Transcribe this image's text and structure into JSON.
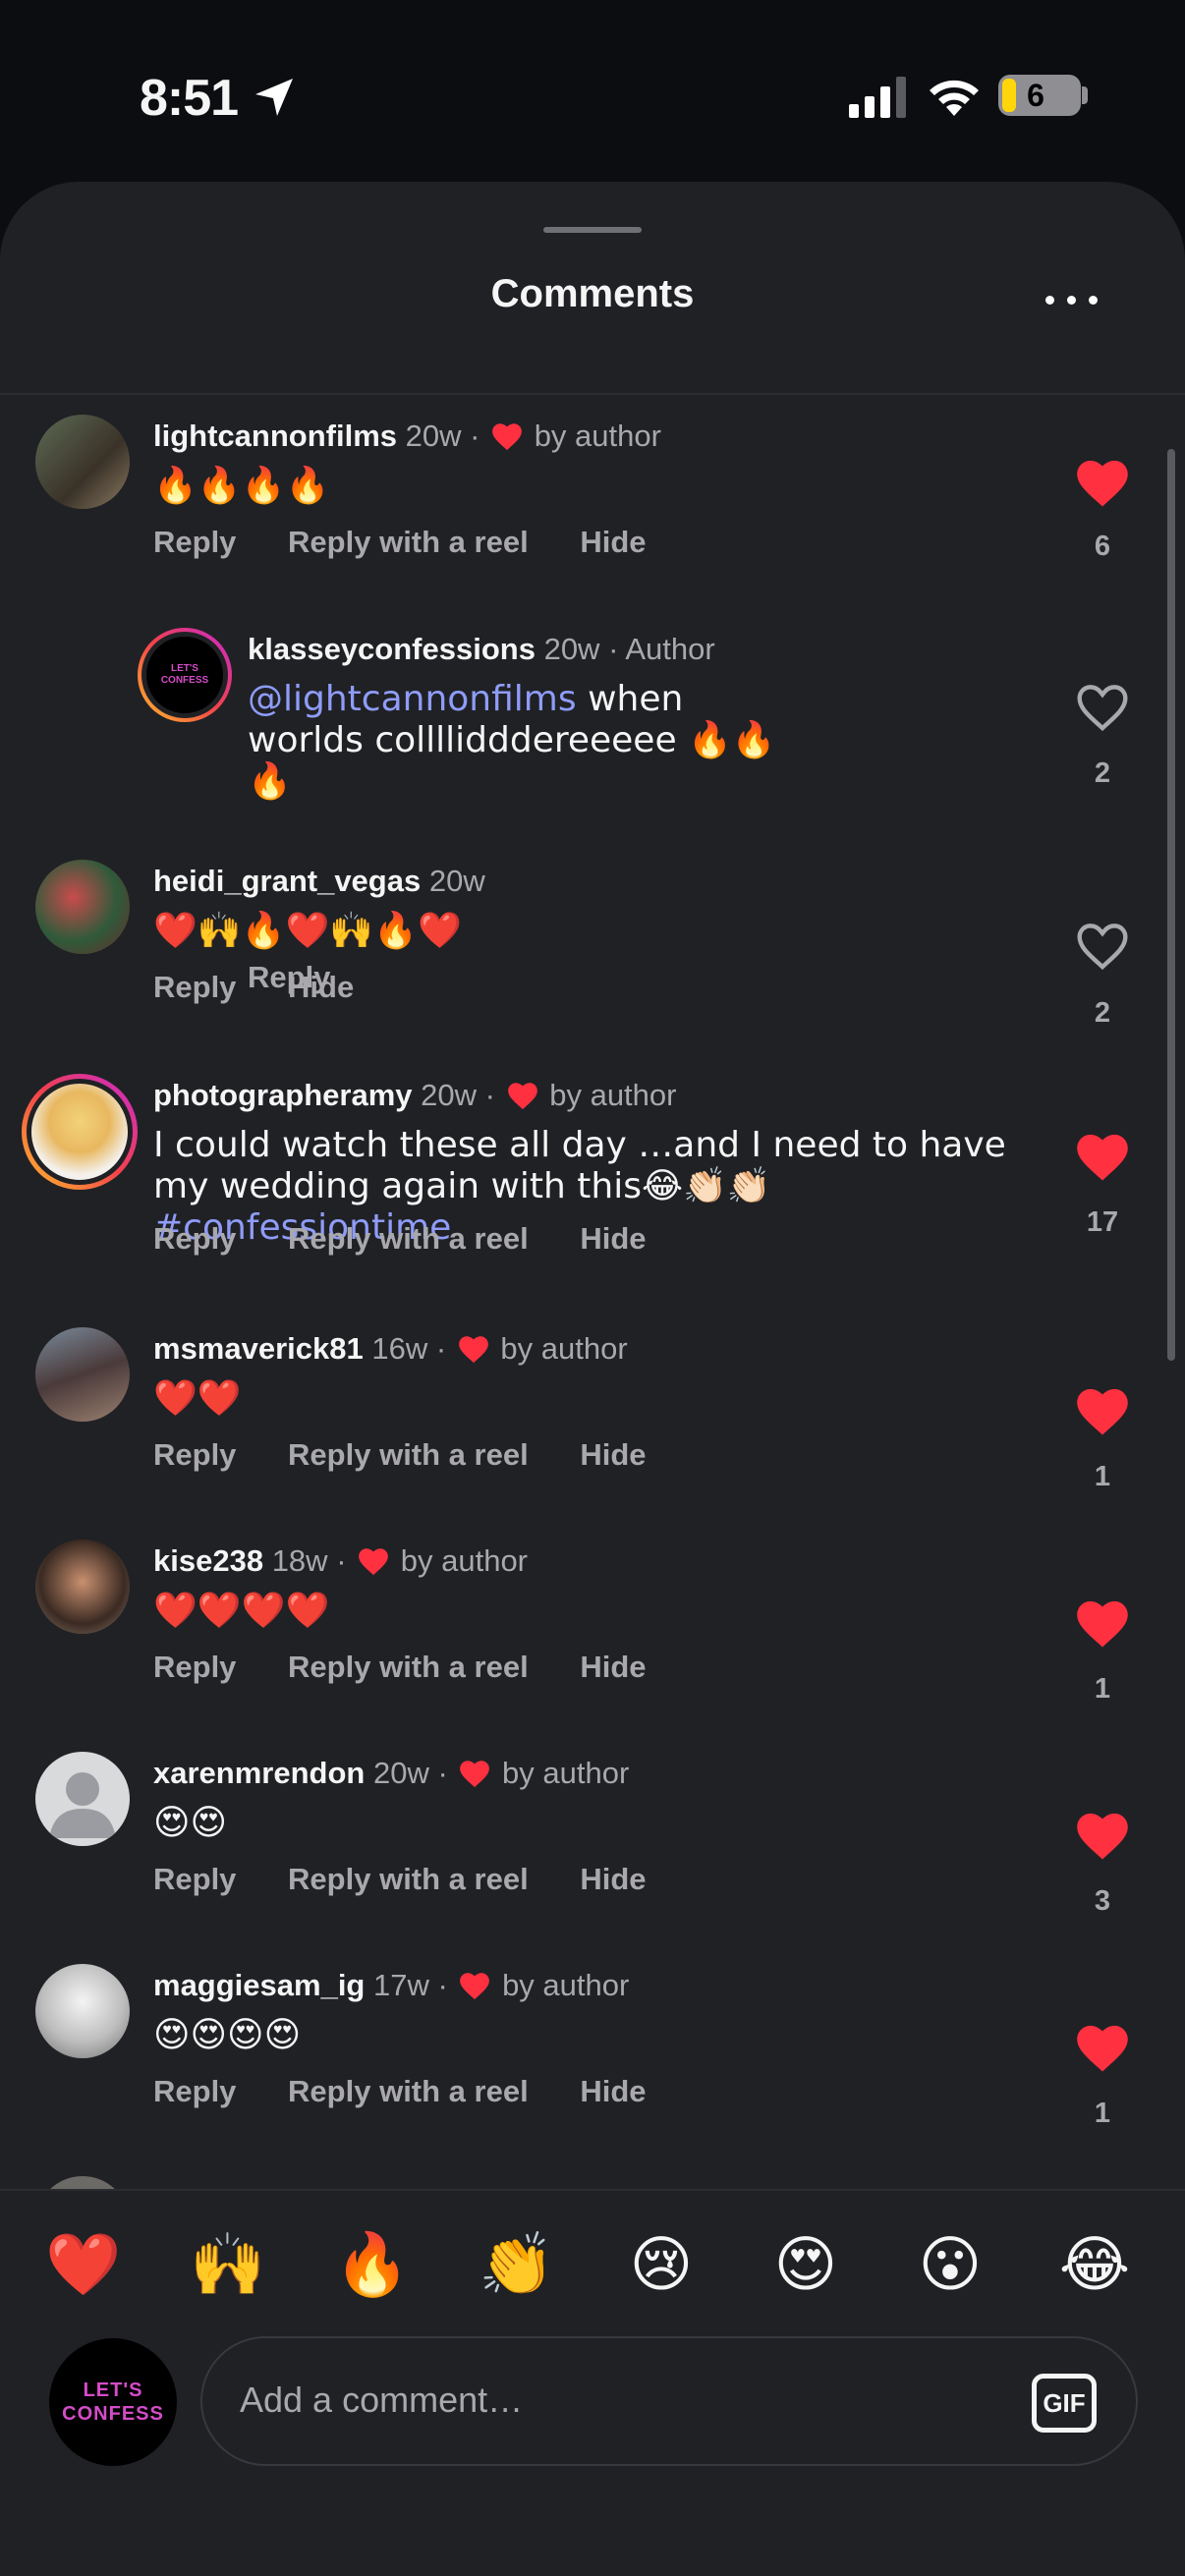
{
  "status_bar": {
    "time": "8:51",
    "battery_level": "6"
  },
  "sheet": {
    "title": "Comments"
  },
  "comments": [
    {
      "username": "lightcannonfilms",
      "age": "20w",
      "meta_suffix": "by author",
      "liked_by_author": true,
      "body": "🔥🔥🔥🔥",
      "actions": [
        "Reply",
        "Reply with a reel",
        "Hide"
      ],
      "liked": true,
      "likes": "6"
    },
    {
      "username": "klasseyconfessions",
      "age": "20w",
      "meta_suffix": "Author",
      "is_reply": true,
      "mention": "@lightcannonfilms",
      "body": " when worlds collllidddereeeee 🔥🔥🔥",
      "actions": [
        "Reply"
      ],
      "liked": false,
      "likes": "2",
      "avatar_text": "LET'S CONFESS"
    },
    {
      "username": "heidi_grant_vegas",
      "age": "20w",
      "body": "❤️🙌🔥❤️🙌🔥❤️",
      "actions": [
        "Reply",
        "Hide"
      ],
      "liked": false,
      "likes": "2"
    },
    {
      "username": "photographeramy",
      "age": "20w",
      "meta_suffix": "by author",
      "liked_by_author": true,
      "body": "I could watch these all day …and I need to have my wedding again with this😂👏🏻👏🏻 ",
      "hashtag": "#confessiontime",
      "actions": [
        "Reply",
        "Reply with a reel",
        "Hide"
      ],
      "liked": true,
      "likes": "17"
    },
    {
      "username": "msmaverick81",
      "age": "16w",
      "meta_suffix": "by author",
      "liked_by_author": true,
      "body": "❤️❤️",
      "actions": [
        "Reply",
        "Reply with a reel",
        "Hide"
      ],
      "liked": true,
      "likes": "1"
    },
    {
      "username": "kise238",
      "age": "18w",
      "meta_suffix": "by author",
      "liked_by_author": true,
      "body": "❤️❤️❤️❤️",
      "actions": [
        "Reply",
        "Reply with a reel",
        "Hide"
      ],
      "liked": true,
      "likes": "1"
    },
    {
      "username": "xarenmrendon",
      "age": "20w",
      "meta_suffix": "by author",
      "liked_by_author": true,
      "body": "😍😍",
      "actions": [
        "Reply",
        "Reply with a reel",
        "Hide"
      ],
      "liked": true,
      "likes": "3"
    },
    {
      "username": "maggiesam_ig",
      "age": "17w",
      "meta_suffix": "by author",
      "liked_by_author": true,
      "body": "😍😍😍😍",
      "actions": [
        "Reply",
        "Reply with a reel",
        "Hide"
      ],
      "liked": true,
      "likes": "1"
    }
  ],
  "quick_reactions": [
    "❤️",
    "🙌",
    "🔥",
    "👏",
    "😢",
    "😍",
    "😮",
    "😂"
  ],
  "composer": {
    "placeholder": "Add a comment…",
    "gif_label": "GIF",
    "avatar_text_line1": "LET'S",
    "avatar_text_line2": "CONFESS"
  },
  "colors": {
    "background": "#202125",
    "like_red": "#ff3040",
    "mention_blue": "#8f9cf8",
    "muted_text": "#a8a8ad"
  }
}
